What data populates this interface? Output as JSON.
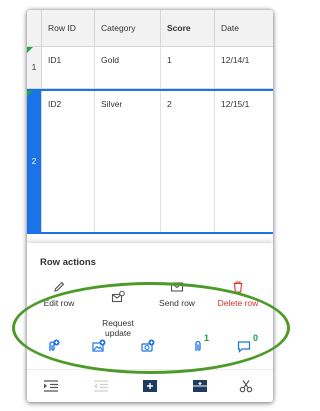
{
  "grid": {
    "columns": [
      "Row ID",
      "Category",
      "Score",
      "Date"
    ],
    "rows": [
      {
        "num": "1",
        "id": "ID1",
        "category": "Gold",
        "score": "1",
        "date": "12/14/1"
      },
      {
        "num": "2",
        "id": "ID2",
        "category": "Silver",
        "score": "2",
        "date": "12/15/1"
      }
    ]
  },
  "sheet": {
    "title": "Row actions",
    "actions": [
      {
        "label": "Edit row",
        "icon": "pencil-icon"
      },
      {
        "label": "Request\nupdate",
        "icon": "request-update-icon"
      },
      {
        "label": "Send row",
        "icon": "envelope-icon"
      },
      {
        "label": "Delete row",
        "icon": "trash-icon"
      }
    ],
    "quick_actions": [
      {
        "icon": "add-attachment-icon"
      },
      {
        "icon": "add-image-icon"
      },
      {
        "icon": "add-photo-icon"
      },
      {
        "icon": "attachments-icon",
        "count": "1"
      },
      {
        "icon": "comments-icon",
        "count": "0"
      }
    ]
  },
  "toolbar": {
    "buttons": [
      "indent-icon",
      "outdent-icon",
      "insert-row-icon",
      "add-row-icon",
      "cut-icon"
    ]
  },
  "colors": {
    "accent": "#1a73e8",
    "danger": "#d9302c",
    "count_green": "#1aa04b",
    "annotation": "#4c9a2a"
  }
}
